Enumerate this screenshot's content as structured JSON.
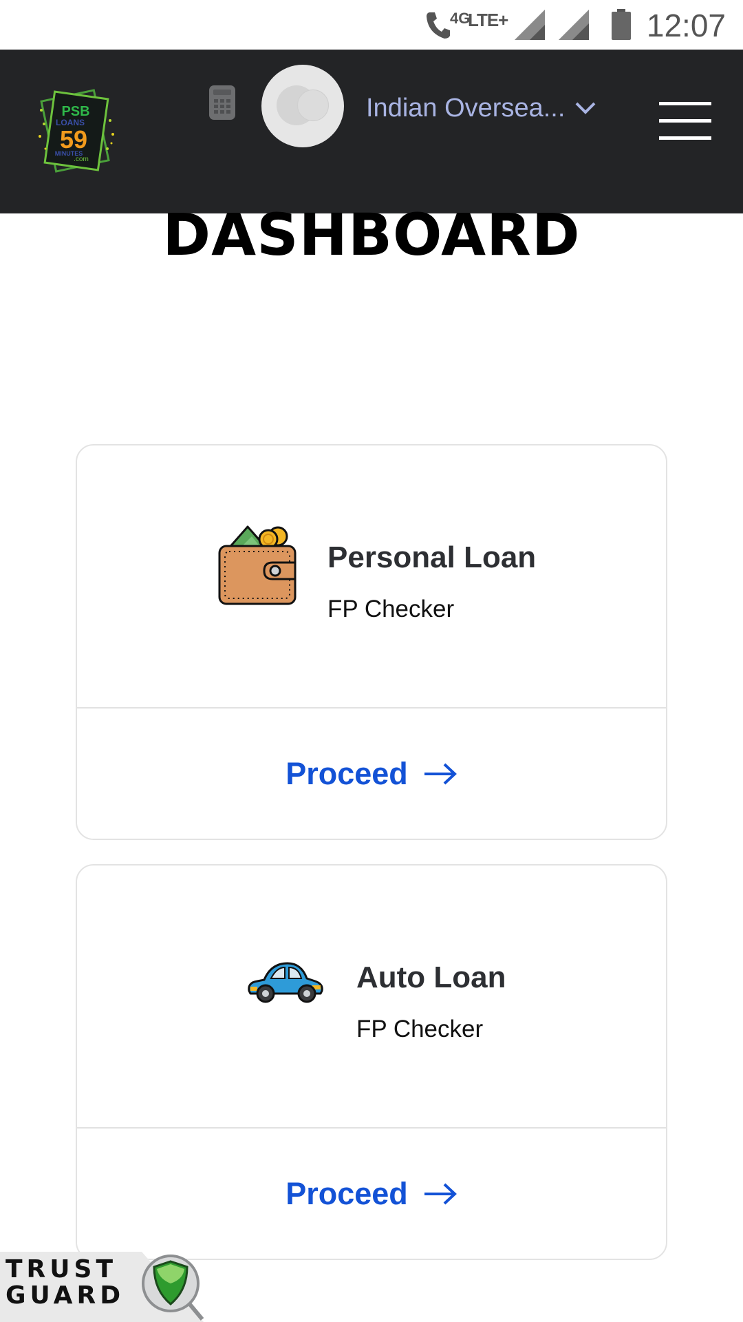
{
  "status_bar": {
    "network_badge": "4G",
    "network_type": "LTE+",
    "time": "12:07",
    "icons": [
      "call-icon",
      "signal-icon",
      "signal-icon",
      "battery-icon"
    ]
  },
  "header": {
    "logo": {
      "name": "psb-loans-59-minutes-logo",
      "text_lines": [
        "PSB",
        "LOANS",
        "59",
        "MINUTES",
        ".com"
      ]
    },
    "calculator_icon": "calculator-icon",
    "avatar_icon": "avatar-icon",
    "bank_selector": {
      "value": "Indian Oversea...",
      "icon": "chevron-down-icon"
    },
    "menu_icon": "hamburger-menu-icon"
  },
  "page_title": "DASHBOARD",
  "cards": [
    {
      "icon": "wallet-icon",
      "title": "Personal Loan",
      "subtitle": "FP Checker",
      "action_label": "Proceed",
      "action_icon": "arrow-right-icon"
    },
    {
      "icon": "car-icon",
      "title": "Auto Loan",
      "subtitle": "FP Checker",
      "action_label": "Proceed",
      "action_icon": "arrow-right-icon"
    }
  ],
  "trust_badge": {
    "line1": "TRUST",
    "line2": "GUARD",
    "icon": "shield-icon"
  },
  "colors": {
    "header_bg": "#232426",
    "bank_text": "#a9b4e3",
    "proceed": "#1352d6",
    "card_border": "#e3e3e3"
  }
}
